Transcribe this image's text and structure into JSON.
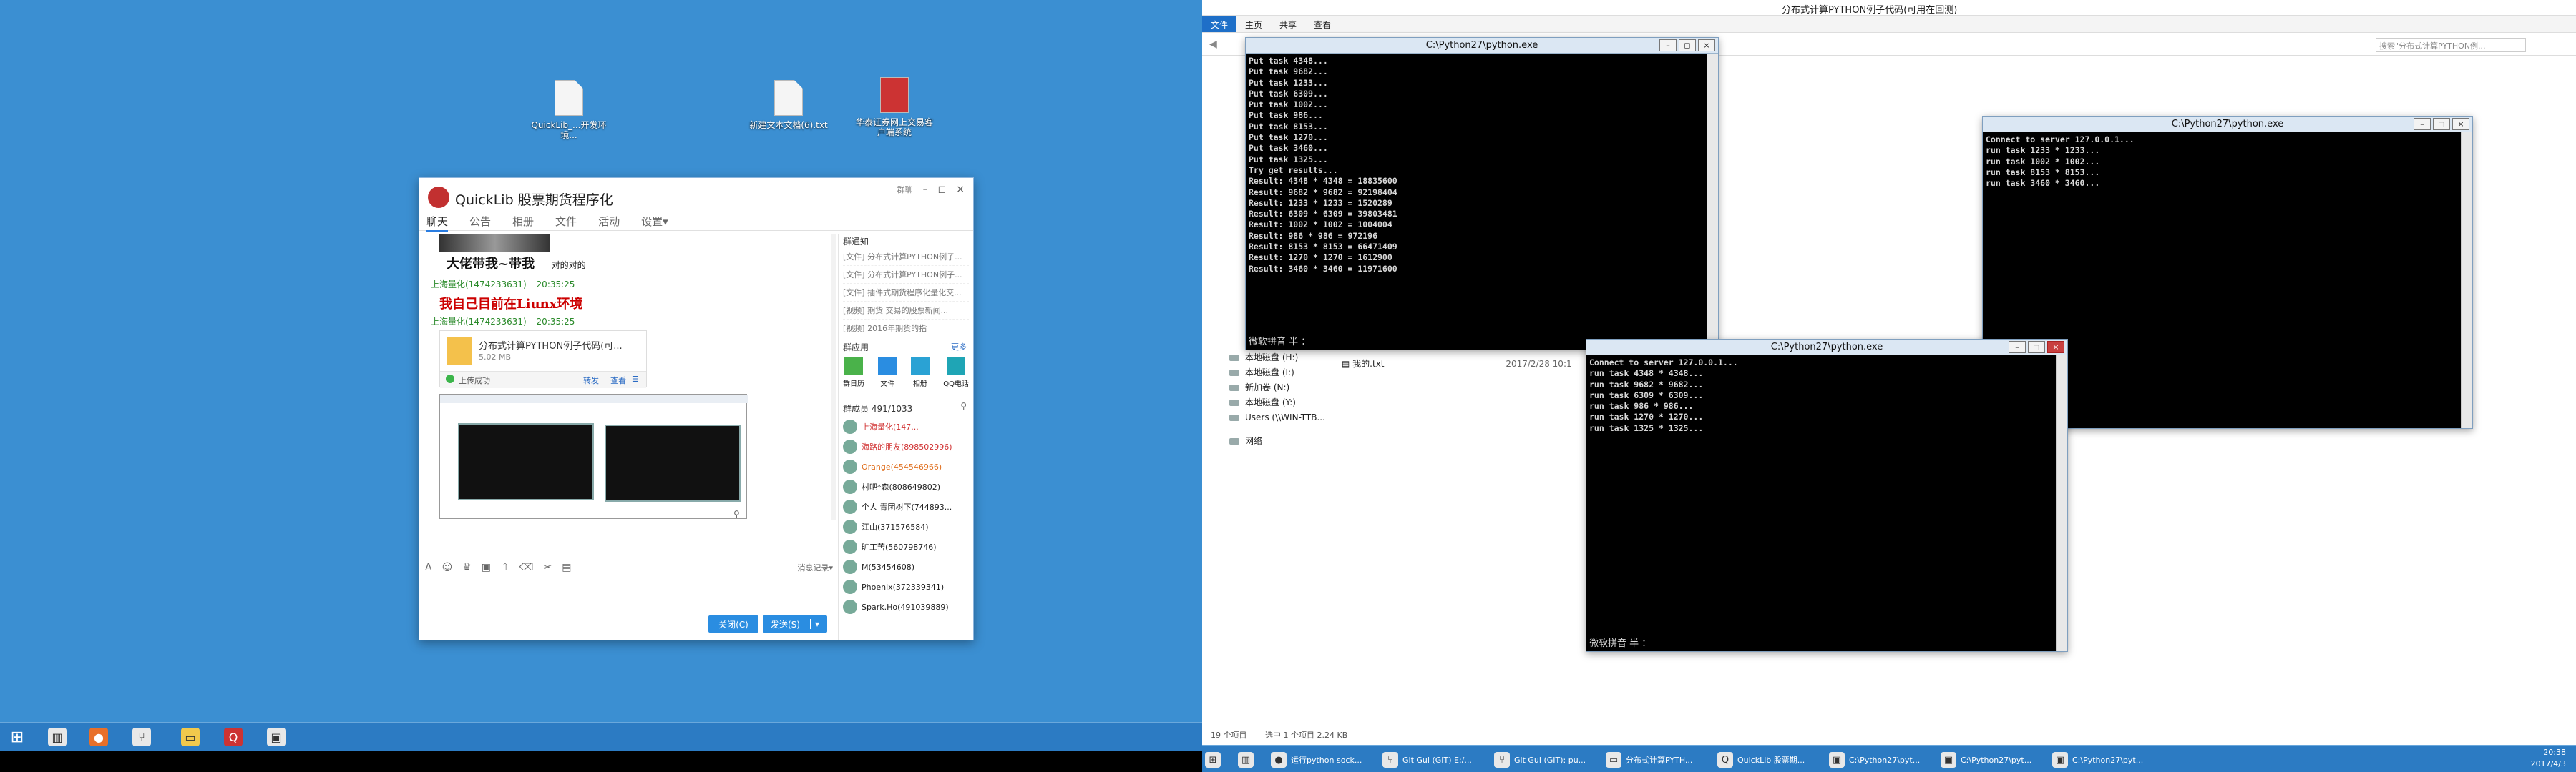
{
  "desktop_icons": [
    {
      "label": "QuickLib_...开发环境...",
      "icon": "document-icon"
    },
    {
      "label": "新建文本文档(6).txt",
      "icon": "text-file-icon"
    },
    {
      "label": "华泰证券网上交易客户端系统",
      "icon": "app-shortcut-icon"
    }
  ],
  "qq": {
    "title": "QuickLib 股票期货程序化",
    "tabs": [
      "聊天",
      "公告",
      "相册",
      "文件",
      "活动",
      "设置▾"
    ],
    "window_actions": [
      "群聊",
      "–",
      "◻",
      "×"
    ],
    "messages": [
      {
        "type": "banner",
        "text": "大佬带我~带我",
        "extra": "对的对的"
      },
      {
        "type": "name",
        "user": "上海量化(1474233631)",
        "time": "20:35:25"
      },
      {
        "type": "banner_red",
        "text": "我自己目前在Liunx环境"
      },
      {
        "type": "name",
        "user": "上海量化(1474233631)",
        "time": "20:35:25"
      },
      {
        "type": "file",
        "name": "分布式计算PYTHON例子代码(可...",
        "size": "5.02 MB",
        "status": "上传成功",
        "actions": [
          "转发",
          "查看"
        ]
      }
    ],
    "notice_header": "群通知",
    "notices": [
      "[文件] 分布式计算PYTHON例子...",
      "[文件] 分布式计算PYTHON例子...",
      "[文件] 插件式期货程序化量化交...",
      "[视频] 期货 交易的股票新闻...",
      "[视频] 2016年期货的指"
    ],
    "apps_header": "群应用",
    "apps_more": "更多",
    "apps": [
      "群日历",
      "文件",
      "相册",
      "QQ电话"
    ],
    "member_header": "群成员 491/1033",
    "members": [
      {
        "name": "上海量化(147...",
        "color": "#d03030"
      },
      {
        "name": "海路的朋友(898502996)",
        "color": "#d03030"
      },
      {
        "name": "Orange(454546966)",
        "color": "#e07020"
      },
      {
        "name": "村吧*森(808649802)",
        "color": "#333"
      },
      {
        "name": "个人 青团树下(744893...",
        "color": "#333"
      },
      {
        "name": "江山(371576584)",
        "color": "#333"
      },
      {
        "name": "旷工苦(560798746)",
        "color": "#333"
      },
      {
        "name": "M(53454608)",
        "color": "#333"
      },
      {
        "name": "Phoenix(372339341)",
        "color": "#333"
      },
      {
        "name": "Spark.Ho(491039889)",
        "color": "#333"
      }
    ],
    "input_toolbar_right": "消息记录▾",
    "close_button": "关闭(C)",
    "send_button": "发送(S)"
  },
  "left_taskbar": {
    "items": [
      "start-icon",
      "server-manager-icon",
      "firefox-icon",
      "git-icon",
      "explorer-icon",
      "qq-icon",
      "python-icon"
    ]
  },
  "explorer": {
    "ribbon_title": "分布式计算PYTHON例子代码(可用在回测)",
    "ribbon_tabs": [
      "文件",
      "主页",
      "共享",
      "查看"
    ],
    "search_placeholder": "搜索\"分布式计算PYTHON例...",
    "nav_rows": [
      "本地磁盘 (H:)",
      "本地磁盘 (I:)",
      "新加卷 (N:)",
      "本地磁盘 (Y:)",
      "Users (\\\\WIN-TTB..."
    ],
    "network_label": "网络",
    "file_name": "我的.txt",
    "file_date": "2017/2/28 10:1",
    "status_left": "19 个项目",
    "status_mid": "选中 1 个项目 2.24 KB"
  },
  "consoles": {
    "server": {
      "title": "C:\\Python27\\python.exe",
      "lines": [
        "Put task 4348...",
        "Put task 9682...",
        "Put task 1233...",
        "Put task 6309...",
        "Put task 1002...",
        "Put task 986...",
        "Put task 8153...",
        "Put task 1270...",
        "Put task 3460...",
        "Put task 1325...",
        "Try get results...",
        "Result: 4348 * 4348 = 18835600",
        "Result: 9682 * 9682 = 92198404",
        "Result: 1233 * 1233 = 1520289",
        "Result: 6309 * 6309 = 39803481",
        "Result: 1002 * 1002 = 1004004",
        "Result: 986 * 986 = 972196",
        "Result: 8153 * 8153 = 66471409",
        "Result: 1270 * 1270 = 1612900",
        "Result: 3460 * 3460 = 11971600"
      ],
      "ime": "微软拼音 半 ："
    },
    "worker1": {
      "title": "C:\\Python27\\python.exe",
      "lines": [
        "Connect to server 127.0.0.1...",
        "run task 1233 * 1233...",
        "run task 1002 * 1002...",
        "run task 8153 * 8153...",
        "run task 3460 * 3460..."
      ]
    },
    "worker2": {
      "title": "C:\\Python27\\python.exe",
      "lines": [
        "Connect to server 127.0.0.1...",
        "run task 4348 * 4348...",
        "run task 9682 * 9682...",
        "run task 6309 * 6309...",
        "run task 986 * 986...",
        "run task 1270 * 1270...",
        "run task 1325 * 1325..."
      ],
      "ime": "微软拼音 半 ："
    }
  },
  "right_taskbar": {
    "items": [
      {
        "label": "",
        "icon": "start-icon"
      },
      {
        "label": "",
        "icon": "server-manager-icon"
      },
      {
        "label": "运行python sock...",
        "icon": "firefox-icon"
      },
      {
        "label": "Git Gui (GIT) E:/...",
        "icon": "git-icon"
      },
      {
        "label": "Git Gui (GIT): pu...",
        "icon": "git-icon"
      },
      {
        "label": "分布式计算PYTH...",
        "icon": "folder-icon"
      },
      {
        "label": "QuickLib 股票期...",
        "icon": "qq-icon"
      },
      {
        "label": "C:\\Python27\\pyt...",
        "icon": "python-icon"
      },
      {
        "label": "C:\\Python27\\pyt...",
        "icon": "python-icon"
      },
      {
        "label": "C:\\Python27\\pyt...",
        "icon": "python-icon"
      }
    ],
    "clock_time": "20:38",
    "clock_date": "2017/4/3"
  }
}
